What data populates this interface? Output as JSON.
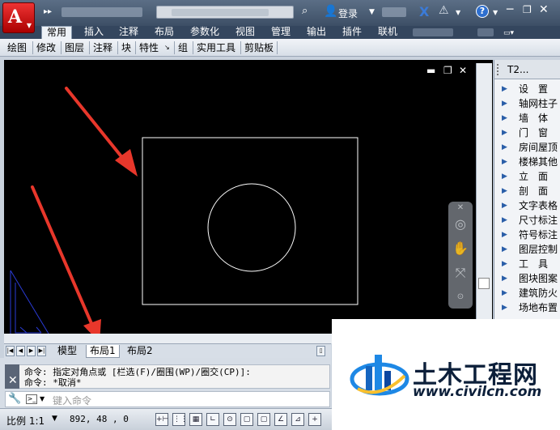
{
  "app": {
    "logo_letter": "A"
  },
  "title_bar": {
    "login_label": "登录",
    "help_label": "?"
  },
  "ribbon": {
    "tabs": [
      "常用",
      "插入",
      "注释",
      "布局",
      "参数化",
      "视图",
      "管理",
      "输出",
      "插件",
      "联机"
    ],
    "active_tab": "常用",
    "panels": [
      "绘图",
      "修改",
      "图层",
      "注释",
      "块",
      "特性",
      "组",
      "实用工具",
      "剪贴板"
    ]
  },
  "viewport": {
    "min_label": "▬",
    "restore_label": "❐",
    "close_label": "✕"
  },
  "layout_tabs": {
    "tabs": [
      "模型",
      "布局1",
      "布局2"
    ],
    "active_tab": "布局1"
  },
  "command": {
    "history": [
      "命令: 指定对角点或 [栏选(F)/圈围(WP)/圈交(CP)]:",
      "命令: *取消*"
    ],
    "input_placeholder": "键入命令"
  },
  "status_bar": {
    "scale_label": "比例 1:1",
    "coordinates": "892, 48 , 0"
  },
  "tool_palette": {
    "title": "T2...",
    "items": [
      "设　置",
      "轴网柱子",
      "墙　体",
      "门　窗",
      "房间屋顶",
      "楼梯其他",
      "立　面",
      "剖　面",
      "文字表格",
      "尺寸标注",
      "符号标注",
      "图层控制",
      "工　具",
      "图块图案",
      "建筑防火",
      "场地布置"
    ]
  },
  "watermark": {
    "title": "土木工程网",
    "url": "www.civilcn.com"
  },
  "colors": {
    "annotation_arrow": "#e8372b",
    "drawing_lines": "#ffffff",
    "ucs_icon": "#2a3bd6",
    "canvas": "#000000"
  }
}
